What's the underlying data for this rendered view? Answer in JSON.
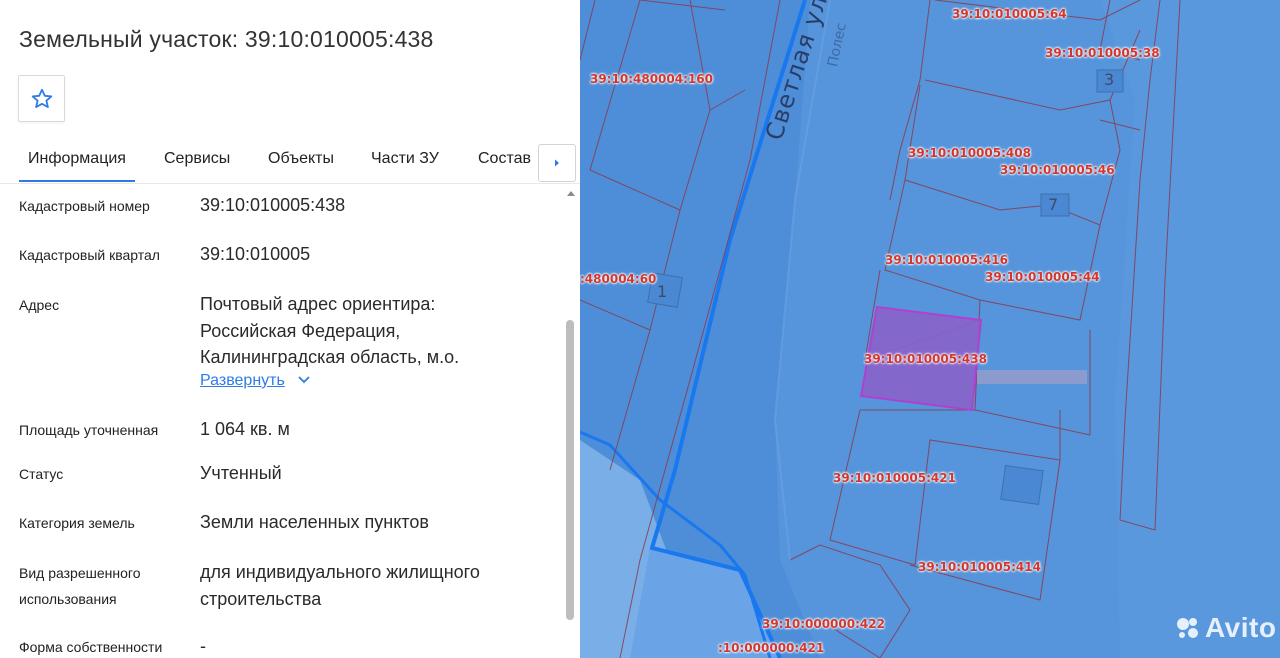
{
  "panel": {
    "title": "Земельный участок: 39:10:010005:438",
    "tabs": [
      "Информация",
      "Сервисы",
      "Объекты",
      "Части ЗУ",
      "Состав"
    ],
    "rows": [
      {
        "label": "Кадастровый номер",
        "value": "39:10:010005:438"
      },
      {
        "label": "Кадастровый квартал",
        "value": "39:10:010005"
      },
      {
        "label": "Адрес",
        "value": "Почтовый адрес ориентира: Российская Федерация, Калининградская область, м.о."
      },
      {
        "label": "Площадь уточненная",
        "value": "1 064 кв. м"
      },
      {
        "label": "Статус",
        "value": "Учтенный"
      },
      {
        "label": "Категория земель",
        "value": "Земли населенных пунктов"
      },
      {
        "label": "Вид разрешенного использования",
        "value": "для индивидуального жилищного строительства"
      },
      {
        "label": "Форма собственности",
        "value": "-"
      }
    ],
    "expand_link": "Развернуть"
  },
  "map": {
    "street_name": "Светлая улица",
    "street_name_top": "Полес",
    "parcels": [
      {
        "id": "p64",
        "label": "39:10:010005:64"
      },
      {
        "id": "p38",
        "label": "39:10:010005:38"
      },
      {
        "id": "p160",
        "label": "39:10:480004:160"
      },
      {
        "id": "p408",
        "label": "39:10:010005:408"
      },
      {
        "id": "p46",
        "label": "39:10:010005:46"
      },
      {
        "id": "p416",
        "label": "39:10:010005:416"
      },
      {
        "id": "p44",
        "label": "39:10:010005:44"
      },
      {
        "id": "p60",
        "label": ":480004:60"
      },
      {
        "id": "p438",
        "label": "39:10:010005:438"
      },
      {
        "id": "p421",
        "label": "39:10:010005:421"
      },
      {
        "id": "p414",
        "label": "39:10:010005:414"
      },
      {
        "id": "p422",
        "label": "39:10:000000:422"
      },
      {
        "id": "p421b",
        "label": ":10:000000:421"
      }
    ],
    "building_numbers": [
      "3",
      "7",
      "1"
    ],
    "watermark": "Avito"
  },
  "colors": {
    "accent": "#2d7be5",
    "map_water": "#4f8fd9",
    "selected_parcel": "#a040c0",
    "parcel_label": "#d2362e"
  }
}
